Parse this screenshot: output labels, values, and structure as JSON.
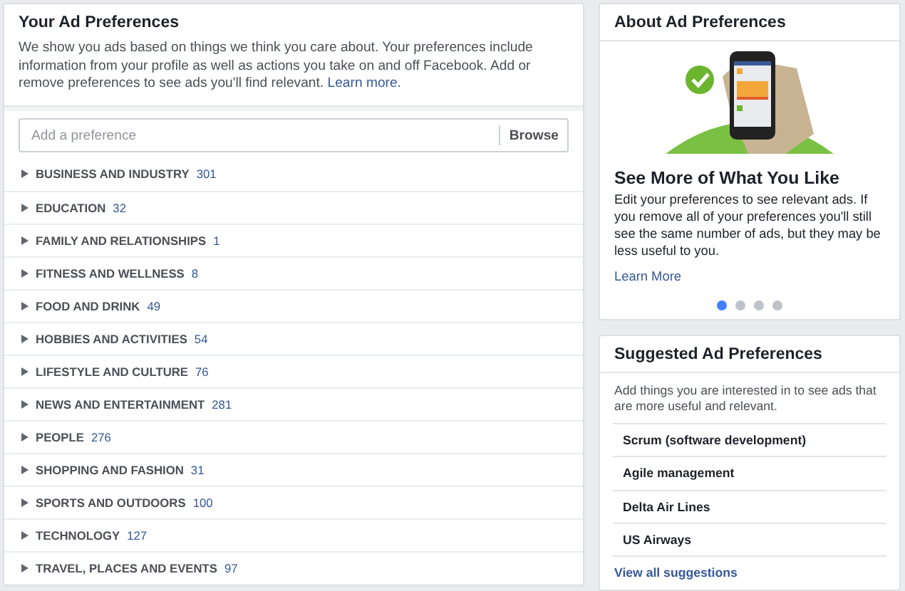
{
  "preferences": {
    "title": "Your Ad Preferences",
    "intro": "We show you ads based on things we think you care about. Your preferences include information from your profile as well as actions you take on and off Facebook. Add or remove preferences to see ads you'll find relevant.",
    "intro_link": "Learn more.",
    "search": {
      "placeholder": "Add a preference",
      "button": "Browse"
    },
    "categories": [
      {
        "label": "BUSINESS AND INDUSTRY",
        "count": "301",
        "expanded": false
      },
      {
        "label": "EDUCATION",
        "count": "32",
        "expanded": false
      },
      {
        "label": "FAMILY AND RELATIONSHIPS",
        "count": "1",
        "expanded": false
      },
      {
        "label": "FITNESS AND WELLNESS",
        "count": "8",
        "expanded": false
      },
      {
        "label": "FOOD AND DRINK",
        "count": "49",
        "expanded": false
      },
      {
        "label": "HOBBIES AND ACTIVITIES",
        "count": "54",
        "expanded": false
      },
      {
        "label": "LIFESTYLE AND CULTURE",
        "count": "76",
        "expanded": false
      },
      {
        "label": "NEWS AND ENTERTAINMENT",
        "count": "281",
        "expanded": false
      },
      {
        "label": "PEOPLE",
        "count": "276",
        "expanded": false
      },
      {
        "label": "SHOPPING AND FASHION",
        "count": "31",
        "expanded": false
      },
      {
        "label": "SPORTS AND OUTDOORS",
        "count": "100",
        "expanded": false
      },
      {
        "label": "TECHNOLOGY",
        "count": "127",
        "expanded": false
      },
      {
        "label": "TRAVEL, PLACES AND EVENTS",
        "count": "97",
        "expanded": false
      }
    ]
  },
  "about": {
    "title": "About Ad Preferences",
    "headline": "See More of What You Like",
    "text": "Edit your preferences to see relevant ads. If you remove all of your preferences you'll still see the same number of ads, but they may be less useful to you.",
    "link": "Learn More",
    "dots": [
      {
        "selected": true
      },
      {
        "selected": false
      },
      {
        "selected": false
      },
      {
        "selected": false
      }
    ]
  },
  "suggested": {
    "title": "Suggested Ad Preferences",
    "text": "Add things you are interested in to see ads that are more useful and relevant.",
    "items": [
      "Scrum (software development)",
      "Agile management",
      "Delta Air Lines",
      "US Airways"
    ],
    "link": "View all suggestions"
  }
}
